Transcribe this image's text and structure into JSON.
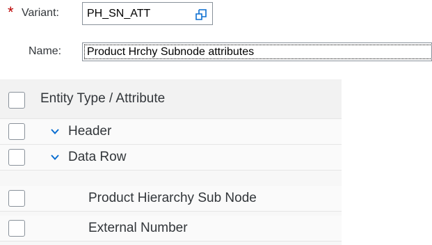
{
  "form": {
    "required_marker": "*",
    "variant_label": "Variant:",
    "variant_value": "PH_SN_ATT",
    "name_label": "Name:",
    "name_value": "Product Hrchy Subnode attributes"
  },
  "table": {
    "column_header": "Entity Type / Attribute",
    "rows": [
      {
        "label": "Header",
        "expandable": true,
        "level": 1
      },
      {
        "label": "Data Row",
        "expandable": true,
        "level": 1
      },
      {
        "label": "Product Hierarchy Sub Node",
        "expandable": false,
        "level": 2
      },
      {
        "label": "External Number",
        "expandable": false,
        "level": 2
      }
    ]
  },
  "colors": {
    "required": "#bb0000",
    "accent": "#0a6ed1",
    "text": "#32363a",
    "border": "#89919a"
  },
  "icons": {
    "value_help": "value-help-icon",
    "expand": "chevron-down-icon"
  }
}
